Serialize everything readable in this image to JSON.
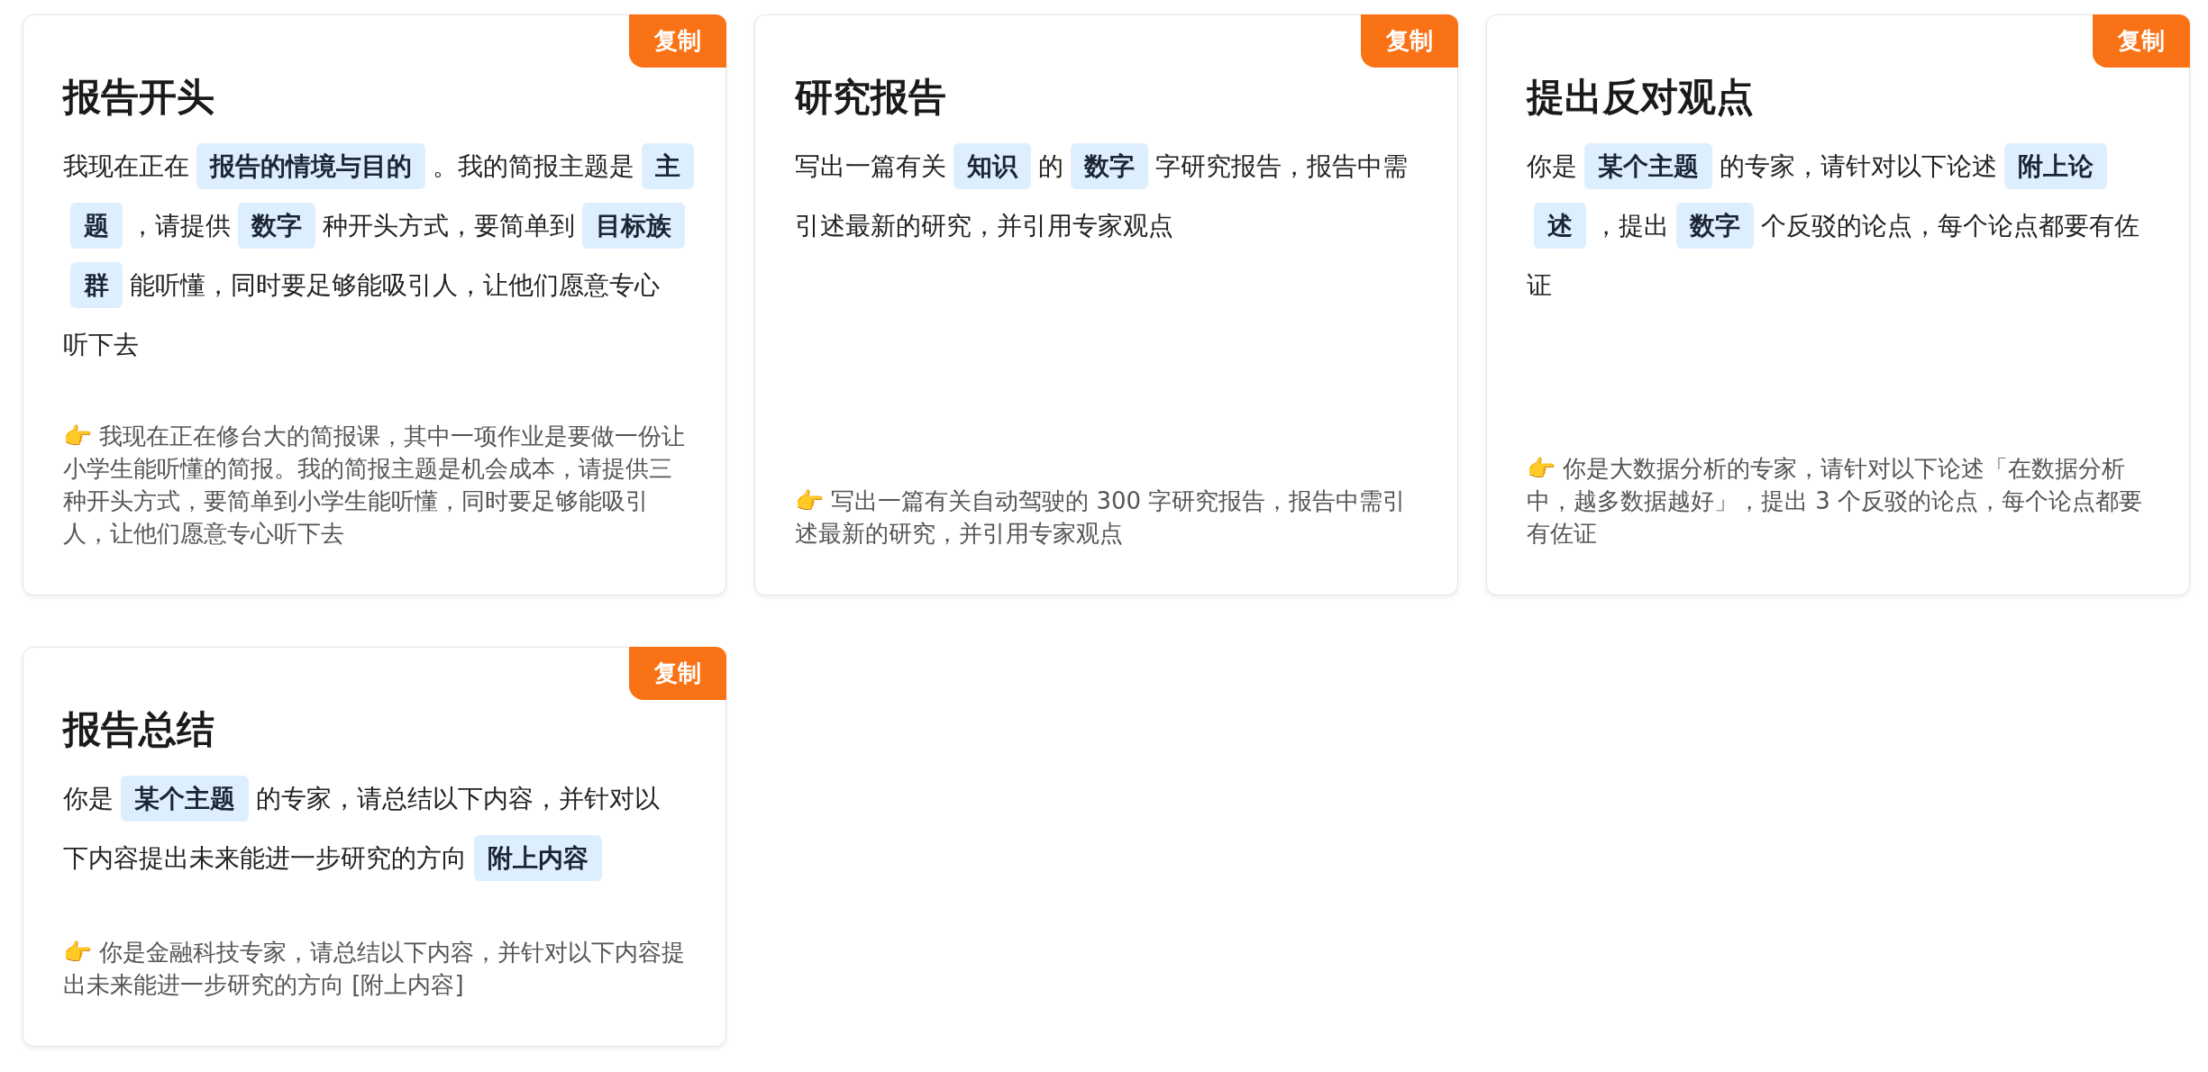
{
  "cards": [
    {
      "copy_button": "复制",
      "title": "报告开头",
      "prompt": [
        {
          "kind": "text",
          "text": "我现在正在"
        },
        {
          "kind": "var",
          "text": "报告的情境与目的"
        },
        {
          "kind": "text",
          "text": "。我的简报主题是"
        },
        {
          "kind": "var",
          "text": "主题"
        },
        {
          "kind": "text",
          "text": "，请提供"
        },
        {
          "kind": "var",
          "text": "数字"
        },
        {
          "kind": "text",
          "text": "种开头方式，要简单到"
        },
        {
          "kind": "var",
          "text": "目标族群"
        },
        {
          "kind": "text",
          "text": "能听懂，同时要足够能吸引人，让他们愿意专心听下去"
        }
      ],
      "example": "👉 我现在正在修台大的简报课，其中一项作业是要做一份让小学生能听懂的简报。我的简报主题是机会成本，请提供三种开头方式，要简单到小学生能听懂，同时要足够能吸引人，让他们愿意专心听下去"
    },
    {
      "copy_button": "复制",
      "title": "研究报告",
      "prompt": [
        {
          "kind": "text",
          "text": "写出一篇有关"
        },
        {
          "kind": "var",
          "text": "知识"
        },
        {
          "kind": "text",
          "text": "的"
        },
        {
          "kind": "var",
          "text": "数字"
        },
        {
          "kind": "text",
          "text": "字研究报告，报告中需引述最新的研究，并引用专家观点"
        }
      ],
      "example": "👉 写出一篇有关自动驾驶的 300 字研究报告，报告中需引述最新的研究，并引用专家观点"
    },
    {
      "copy_button": "复制",
      "title": "提出反对观点",
      "prompt": [
        {
          "kind": "text",
          "text": "你是"
        },
        {
          "kind": "var",
          "text": "某个主题"
        },
        {
          "kind": "text",
          "text": "的专家，请针对以下论述"
        },
        {
          "kind": "var",
          "text": "附上论述"
        },
        {
          "kind": "text",
          "text": "，提出"
        },
        {
          "kind": "var",
          "text": "数字"
        },
        {
          "kind": "text",
          "text": "个反驳的论点，每个论点都要有佐证"
        }
      ],
      "example": "👉 你是大数据分析的专家，请针对以下论述「在数据分析中，越多数据越好」，提出 3 个反驳的论点，每个论点都要有佐证"
    },
    {
      "copy_button": "复制",
      "title": "报告总结",
      "prompt": [
        {
          "kind": "text",
          "text": "你是"
        },
        {
          "kind": "var",
          "text": "某个主题"
        },
        {
          "kind": "text",
          "text": "的专家，请总结以下内容，并针对以下内容提出未来能进一步研究的方向"
        },
        {
          "kind": "var",
          "text": "附上内容"
        }
      ],
      "example": "👉 你是金融科技专家，请总结以下内容，并针对以下内容提出未来能进一步研究的方向 [附上内容]"
    }
  ]
}
